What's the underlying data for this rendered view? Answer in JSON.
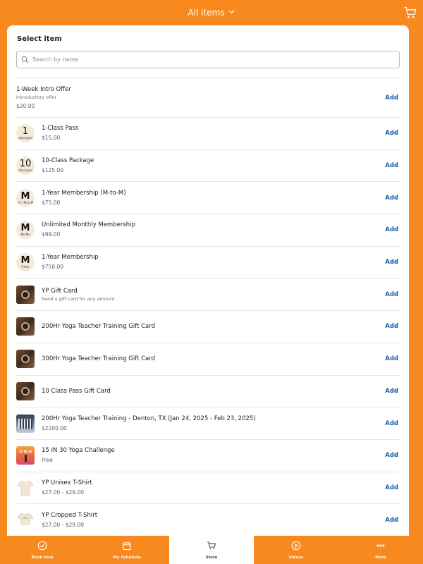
{
  "header": {
    "title": "All items",
    "chevron_icon": "chevron-down-icon",
    "cart_icon": "cart-icon"
  },
  "panel": {
    "title": "Select item"
  },
  "search": {
    "placeholder": "Search by name",
    "value": "",
    "icon": "search-icon"
  },
  "items": [
    {
      "name": "1-Week Intro Offer",
      "subtitle": "Introductory offer",
      "price": "$20.00",
      "thumb": "none",
      "add_label": "Add"
    },
    {
      "name": "1-Class Pass",
      "subtitle": "",
      "price": "$15.00",
      "thumb": "pass",
      "thumb_big": "1",
      "thumb_small": "class pass",
      "add_label": "Add"
    },
    {
      "name": "10-Class Package",
      "subtitle": "",
      "price": "$125.00",
      "thumb": "pass",
      "thumb_big": "10",
      "thumb_small": "class pass",
      "add_label": "Add"
    },
    {
      "name": "1-Year Membership (M-to-M)",
      "subtitle": "",
      "price": "$75.00",
      "thumb": "memb",
      "thumb_big": "M",
      "thumb_small": "1-Yr M-to-M",
      "add_label": "Add"
    },
    {
      "name": "Unlimited Monthly Membership",
      "subtitle": "",
      "price": "$99.00",
      "thumb": "memb",
      "thumb_big": "M",
      "thumb_small": "Mo-Mo",
      "add_label": "Add"
    },
    {
      "name": "1-Year Membership",
      "subtitle": "",
      "price": "$750.00",
      "thumb": "memb",
      "thumb_big": "M",
      "thumb_small": "1-Year",
      "add_label": "Add"
    },
    {
      "name": "YP Gift Card",
      "subtitle": "Send a gift card for any amount",
      "price": "",
      "thumb": "gift",
      "add_label": "Add"
    },
    {
      "name": "200Hr Yoga Teacher Training Gift Card",
      "subtitle": "",
      "price": "",
      "thumb": "gift",
      "add_label": "Add"
    },
    {
      "name": "300Hr Yoga Teacher Training Gift Card",
      "subtitle": "",
      "price": "",
      "thumb": "gift",
      "add_label": "Add"
    },
    {
      "name": "10 Class Pass Gift Card",
      "subtitle": "",
      "price": "",
      "thumb": "gift",
      "add_label": "Add"
    },
    {
      "name": "200Hr Yoga Teacher Training - Denton, TX (Jan 24, 2025 - Feb 23, 2025)",
      "subtitle": "",
      "price": "$2200.00",
      "thumb": "training",
      "add_label": "Add"
    },
    {
      "name": "15 IN 30 Yoga Challenge",
      "subtitle": "",
      "price": "Free",
      "thumb": "challenge",
      "thumb_text": "15 IN 30",
      "add_label": "Add"
    },
    {
      "name": "YP Unisex T-Shirt",
      "subtitle": "",
      "price": "$27.00 - $29.00",
      "thumb": "shirt",
      "add_label": "Add"
    },
    {
      "name": "YP Cropped T-Shirt",
      "subtitle": "",
      "price": "$27.00 - $29.00",
      "thumb": "shirt-cropped",
      "add_label": "Add"
    }
  ],
  "nav": [
    {
      "label": "Book Now",
      "icon": "check-circle-icon",
      "active": false
    },
    {
      "label": "My Schedule",
      "icon": "calendar-icon",
      "active": false
    },
    {
      "label": "Store",
      "icon": "cart-icon",
      "active": true
    },
    {
      "label": "Videos",
      "icon": "play-circle-icon",
      "active": false
    },
    {
      "label": "More",
      "icon": "more-icon",
      "active": false
    }
  ],
  "colors": {
    "brand_orange": "#f7891f",
    "link_blue": "#1a5aa8"
  }
}
